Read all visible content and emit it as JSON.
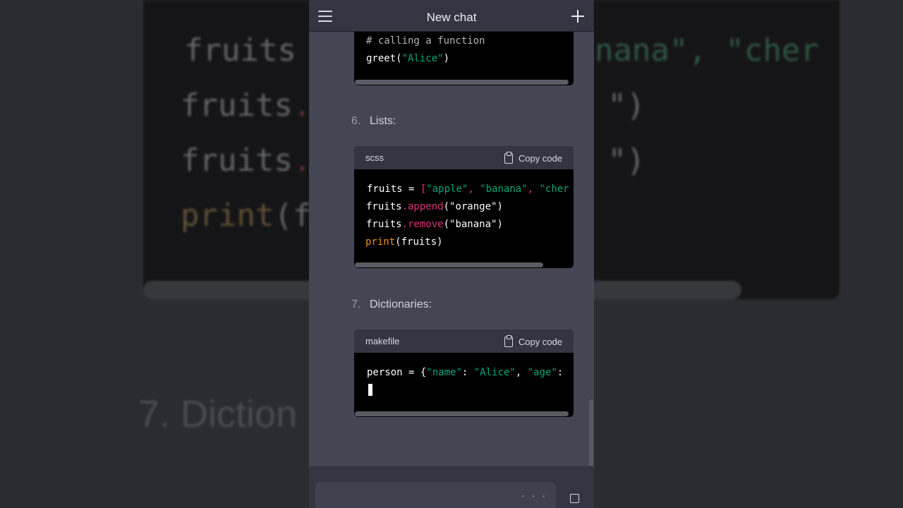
{
  "header": {
    "title": "New chat"
  },
  "background": {
    "lines": [
      [
        "fruits ",
        "anana\", ",
        "\"cher"
      ],
      [
        "fruits",
        ".",
        "\")"
      ],
      [
        "fruits",
        ".",
        "\")"
      ],
      [
        "print",
        "(f"
      ]
    ],
    "heading": "7.  Diction"
  },
  "blocks": {
    "function": {
      "line1": "# calling a function",
      "line2_fn": "greet(",
      "line2_str": "\"Alice\"",
      "line2_end": ")"
    },
    "lists": {
      "number": "6.",
      "heading": "Lists:",
      "lang": "scss",
      "copy_label": "Copy code",
      "l1a": "fruits = ",
      "l1b": "[",
      "l1c": "\"apple\"",
      "l1d": ", ",
      "l1e": "\"banana\"",
      "l1f": ", ",
      "l1g": "\"cher",
      "l2a": "fruits",
      "l2b": ".append",
      "l2c": "(\"orange\")",
      "l3a": "fruits",
      "l3b": ".remove",
      "l3c": "(\"banana\")",
      "l4a": "print",
      "l4b": "(fruits)"
    },
    "dicts": {
      "number": "7.",
      "heading": "Dictionaries:",
      "lang": "makefile",
      "copy_label": "Copy code",
      "l1a": "person = {",
      "l1b": "\"name\"",
      "l1c": ": ",
      "l1d": "\"Alice\"",
      "l1e": ", ",
      "l1f": "\"age\"",
      "l1g": ":"
    }
  },
  "composer": {
    "dots": "· · ·"
  }
}
